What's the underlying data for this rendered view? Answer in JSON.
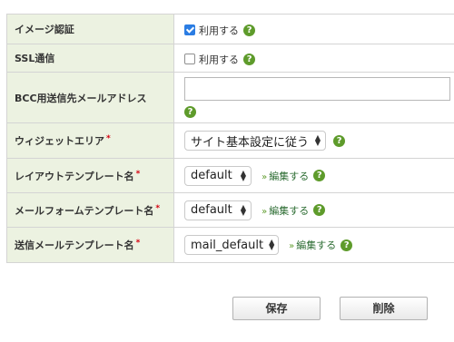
{
  "rows": {
    "image_auth": {
      "label": "イメージ認証",
      "checkbox_label": "利用する",
      "checked": true
    },
    "ssl": {
      "label": "SSL通信",
      "checkbox_label": "利用する",
      "checked": false
    },
    "bcc": {
      "label": "BCC用送信先メールアドレス",
      "value": "",
      "placeholder": ""
    },
    "widget_area": {
      "label": "ウィジェットエリア",
      "required_mark": "*",
      "selected": "サイト基本設定に従う"
    },
    "layout_template": {
      "label": "レイアウトテンプレート名",
      "required_mark": "*",
      "selected": "default",
      "edit_link": "編集する"
    },
    "mailform_template": {
      "label": "メールフォームテンプレート名",
      "required_mark": "*",
      "selected": "default",
      "edit_link": "編集する"
    },
    "mail_template": {
      "label": "送信メールテンプレート名",
      "required_mark": "*",
      "selected": "mail_default",
      "edit_link": "編集する"
    }
  },
  "help_icon_glyph": "?",
  "buttons": {
    "save": "保存",
    "delete": "削除"
  },
  "colors": {
    "header_bg": "#ecf2e1",
    "help_icon": "#5e9b2b",
    "required": "#d6000f",
    "link": "#2d6d33"
  }
}
